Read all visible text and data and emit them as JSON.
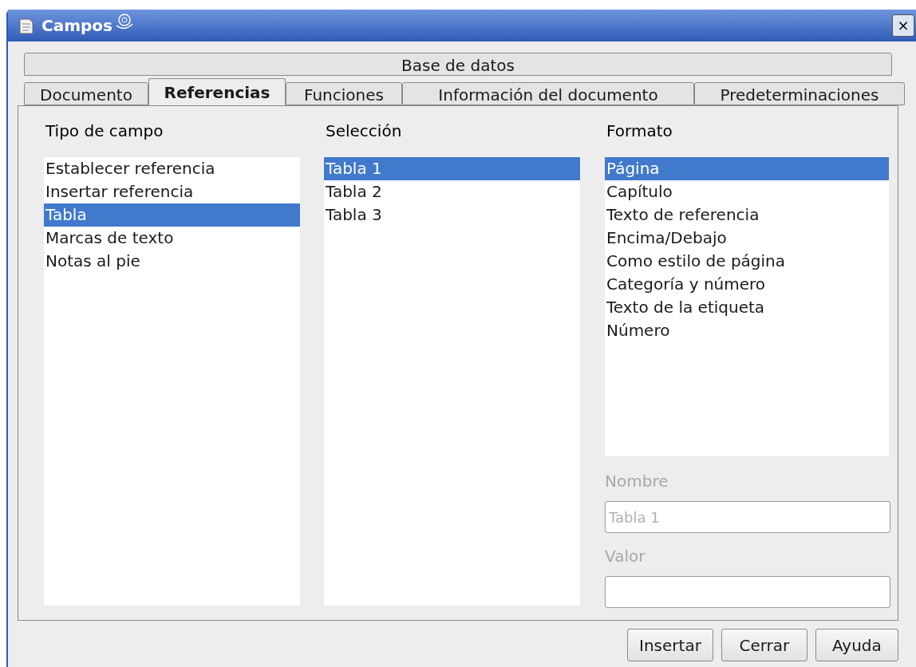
{
  "window": {
    "title": "Campos",
    "close": "×"
  },
  "tab_rows": [
    [
      {
        "label": "Base de datos",
        "selected": false
      }
    ],
    [
      {
        "label": "Documento",
        "selected": false
      },
      {
        "label": "Referencias",
        "selected": true
      },
      {
        "label": "Funciones",
        "selected": false
      },
      {
        "label": "Información del documento",
        "selected": false
      },
      {
        "label": "Predeterminaciones",
        "selected": false
      }
    ]
  ],
  "lists": [
    {
      "label": "Tipo de campo",
      "items": [
        {
          "label": "Establecer referencia",
          "selected": false
        },
        {
          "label": "Insertar referencia",
          "selected": false
        },
        {
          "label": "Tabla",
          "selected": true
        },
        {
          "label": "Marcas de texto",
          "selected": false
        },
        {
          "label": "Notas al pie",
          "selected": false
        }
      ]
    },
    {
      "label": "Selección",
      "items": [
        {
          "label": "Tabla 1",
          "selected": true
        },
        {
          "label": "Tabla 2",
          "selected": false
        },
        {
          "label": "Tabla 3",
          "selected": false
        }
      ]
    },
    {
      "label": "Formato",
      "items": [
        {
          "label": "Página",
          "selected": true
        },
        {
          "label": "Capítulo",
          "selected": false
        },
        {
          "label": "Texto de referencia",
          "selected": false
        },
        {
          "label": "Encima/Debajo",
          "selected": false
        },
        {
          "label": "Como estilo de página",
          "selected": false
        },
        {
          "label": "Categoría y número",
          "selected": false
        },
        {
          "label": "Texto de la etiqueta",
          "selected": false
        },
        {
          "label": "Número",
          "selected": false
        }
      ]
    }
  ],
  "fields": [
    {
      "label": "Nombre",
      "value": "Tabla 1",
      "disabled": true
    },
    {
      "label": "Valor",
      "disabled": true
    }
  ],
  "buttons": [
    {
      "label": "Insertar"
    },
    {
      "label": "Cerrar"
    },
    {
      "label": "Ayuda"
    }
  ]
}
